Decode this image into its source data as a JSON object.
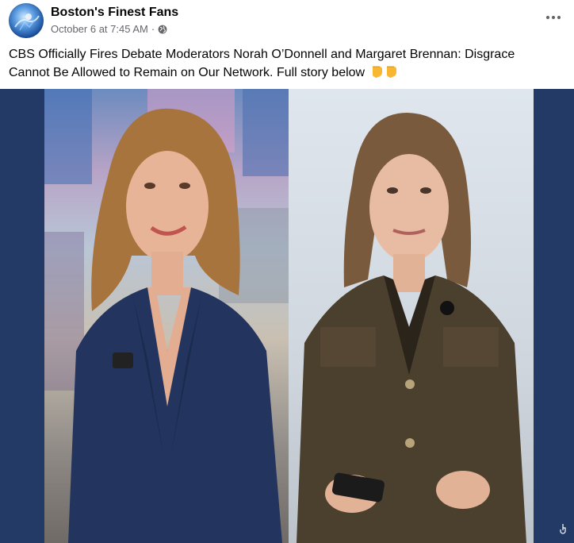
{
  "post": {
    "page_name": "Boston's Finest Fans",
    "timestamp": "October 6 at 7:45 AM",
    "separator": "·",
    "audience_icon": "globe-icon",
    "more_icon": "more-options-icon",
    "caption": "CBS Officially Fires Debate Moderators Norah O’Donnell and Margaret Brennan: Disgrace Cannot Be Allowed to Remain on Our Network. Full story below",
    "caption_emoji": "👇👇",
    "image": {
      "left_subject": "woman in navy blazer",
      "right_subject": "woman in olive jacket"
    }
  },
  "colors": {
    "page_name": "#050505",
    "meta": "#65676b",
    "image_backdrop": "#233a67"
  }
}
